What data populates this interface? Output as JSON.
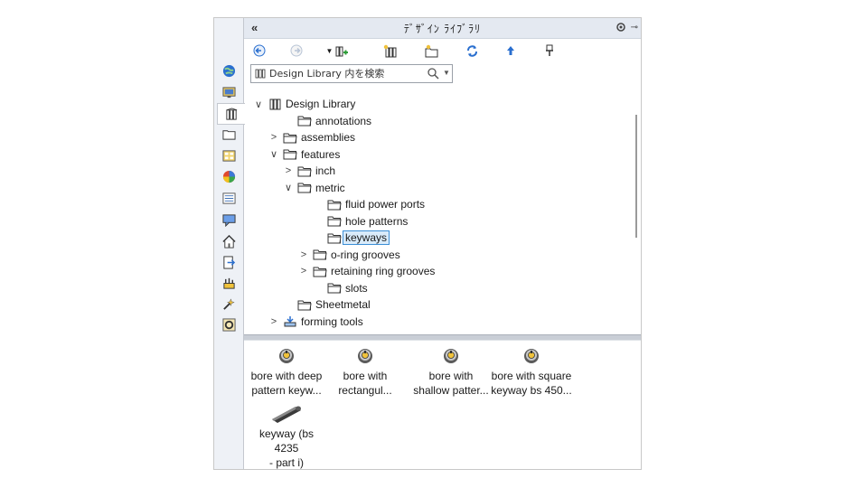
{
  "header": {
    "title": "ﾃﾞｻﾞｲﾝ ﾗｲﾌﾞﾗﾘ",
    "collapse": "«"
  },
  "search": {
    "placeholder": "Design Library 内を検索"
  },
  "tree": [
    {
      "label": "Design Library",
      "twisty": "∨",
      "icon": "library-icon"
    },
    {
      "label": "annotations",
      "twisty": "",
      "icon": "folder-icon"
    },
    {
      "label": "assemblies",
      "twisty": ">",
      "icon": "folder-icon"
    },
    {
      "label": "features",
      "twisty": "∨",
      "icon": "folder-icon"
    },
    {
      "label": "inch",
      "twisty": ">",
      "icon": "folder-icon"
    },
    {
      "label": "metric",
      "twisty": "∨",
      "icon": "folder-icon"
    },
    {
      "label": "fluid power ports",
      "twisty": "",
      "icon": "folder-icon"
    },
    {
      "label": "hole patterns",
      "twisty": "",
      "icon": "folder-icon"
    },
    {
      "label": "keyways",
      "twisty": "",
      "icon": "folder-icon",
      "selected": true
    },
    {
      "label": "o-ring grooves",
      "twisty": ">",
      "icon": "folder-icon"
    },
    {
      "label": "retaining ring grooves",
      "twisty": ">",
      "icon": "folder-icon"
    },
    {
      "label": "slots",
      "twisty": "",
      "icon": "folder-icon"
    },
    {
      "label": "Sheetmetal",
      "twisty": "",
      "icon": "folder-icon"
    },
    {
      "label": "forming tools",
      "twisty": ">",
      "icon": "forming-tools-icon"
    }
  ],
  "items": [
    {
      "line1": "bore with deep",
      "line2": "pattern keyw...",
      "icon": "feature-bore-icon"
    },
    {
      "line1": "bore with",
      "line2": "rectangul...",
      "icon": "feature-bore-icon"
    },
    {
      "line1": "bore with",
      "line2": "shallow patter...",
      "icon": "feature-bore-icon"
    },
    {
      "line1": "bore with square",
      "line2": "keyway bs 450...",
      "icon": "feature-bore-icon"
    },
    {
      "line1": "keyway (bs 4235",
      "line2": "- part i)",
      "icon": "keyway-part-icon"
    }
  ],
  "colors": {
    "accent": "#3d8fd6",
    "selection_bg": "#d9ebfa",
    "strip_bg": "#eef1f6",
    "titlebar_bg": "#e4e9f1"
  }
}
